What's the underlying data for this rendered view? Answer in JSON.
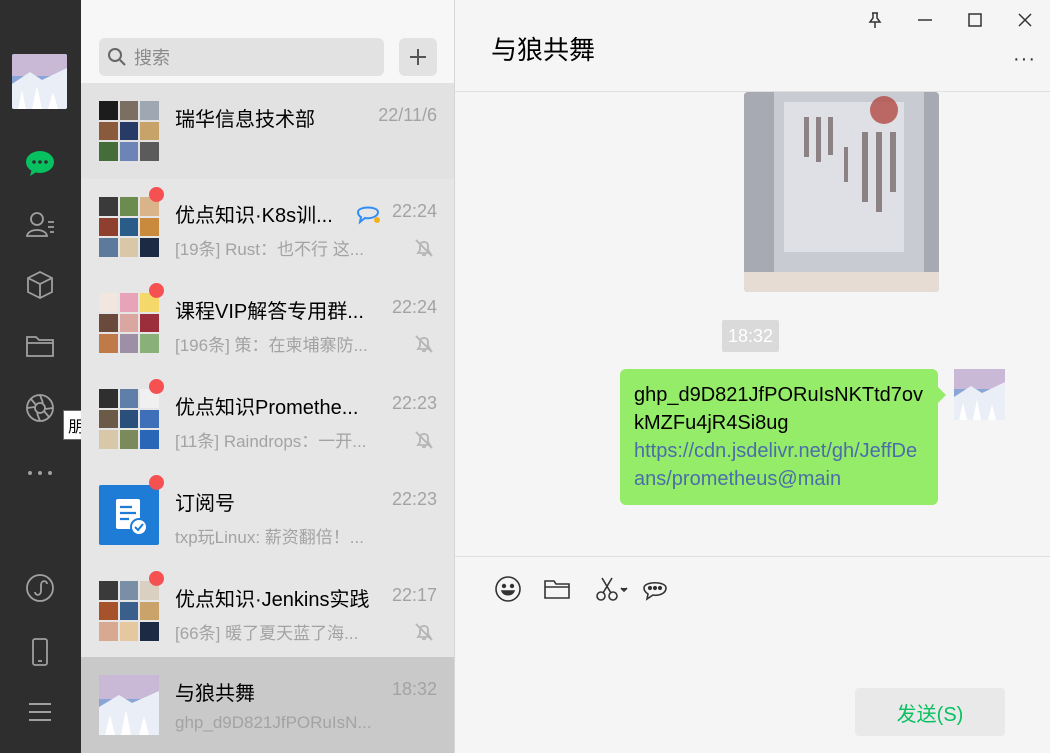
{
  "nav": {
    "tooltip": "朋友圈",
    "icons": [
      "avatar",
      "chat-icon",
      "contacts-icon",
      "collection-icon",
      "folder-icon",
      "moments-icon",
      "more-icon",
      "mini-program-icon",
      "phone-icon",
      "menu-icon"
    ]
  },
  "search": {
    "placeholder": "搜索",
    "add_label": "+"
  },
  "conversations": [
    {
      "name": "瑞华信息技术部",
      "time": "22/11/6",
      "preview": "",
      "unread": false,
      "muted": false
    },
    {
      "name": "优点知识·K8s训...",
      "time": "22:24",
      "preview": "[19条] Rust：也不行 这...",
      "unread": true,
      "muted": true,
      "mention": true
    },
    {
      "name": "课程VIP解答专用群...",
      "time": "22:24",
      "preview": "[196条] 策：在柬埔寨防...",
      "unread": true,
      "muted": true
    },
    {
      "name": "优点知识Promethe...",
      "time": "22:23",
      "preview": "[11条] Raindrops：一开...",
      "unread": true,
      "muted": true
    },
    {
      "name": "订阅号",
      "time": "22:23",
      "preview": "txp玩Linux: 薪资翻倍！...",
      "unread": true,
      "muted": false
    },
    {
      "name": "优点知识·Jenkins实践",
      "time": "22:17",
      "preview": "[66条] 暖了夏天蓝了海...",
      "unread": true,
      "muted": true
    },
    {
      "name": "与狼共舞",
      "time": "18:32",
      "preview": "ghp_d9D821JfPORuIsN...",
      "unread": false,
      "muted": false,
      "selected": true
    }
  ],
  "chat": {
    "title": "与狼共舞",
    "more_label": "···",
    "timestamp": "18:32",
    "message_text": "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",
    "message_link": "https://cdn.jsdelivr.net/gh/JeffDeans/prometheus@main",
    "send_label": "发送(S)"
  },
  "colors": {
    "rail": "#2e2e2e",
    "accent": "#07c160",
    "bubble": "#95ec69",
    "unread_dot": "#f55151",
    "link": "#4a6ea9"
  }
}
